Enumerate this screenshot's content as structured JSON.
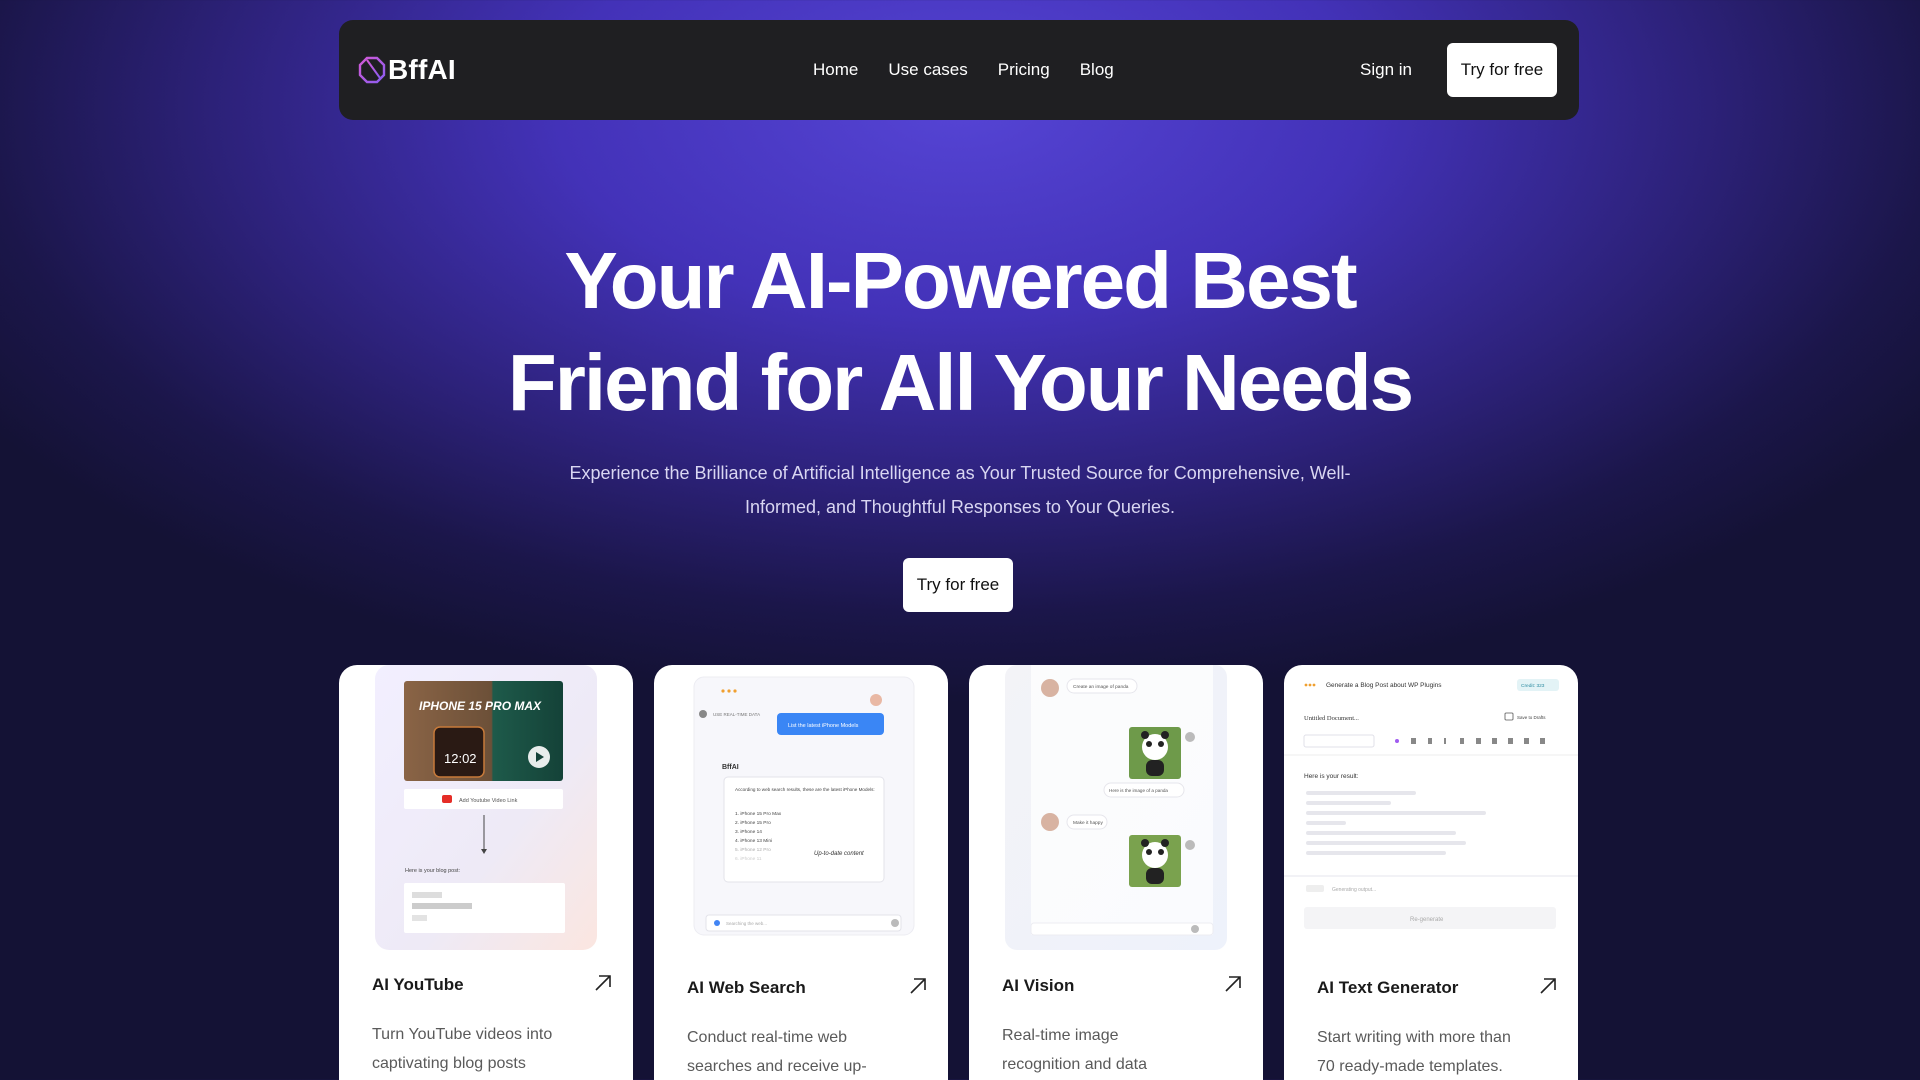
{
  "nav": {
    "logo_text": "BffAI",
    "links": [
      "Home",
      "Use cases",
      "Pricing",
      "Blog"
    ],
    "signin": "Sign in",
    "cta": "Try for free"
  },
  "hero": {
    "title_line1": "Your AI-Powered Best",
    "title_line2": "Friend for All Your Needs",
    "subtitle_line1": "Experience the Brilliance of Artificial Intelligence as Your Trusted Source for Comprehensive, Well-",
    "subtitle_line2": "Informed, and Thoughtful Responses to Your Queries.",
    "cta": "Try for free"
  },
  "cards": [
    {
      "title": "AI YouTube",
      "desc_line1": "Turn YouTube videos into",
      "desc_line2": "captivating blog posts",
      "preview": {
        "video_title": "IPHONE 15 PRO MAX",
        "clock": "12:02",
        "link_label": "Add Youtube Video Link",
        "result_label": "Here is your blog post:"
      }
    },
    {
      "title": "AI Web Search",
      "desc_line1": "Conduct real-time web",
      "desc_line2": "searches and receive up-",
      "preview": {
        "toggle_label": "USE REAL-TIME DATA",
        "query": "List the latest iPhone Models",
        "brand": "BffAI",
        "answer_intro": "According to web search results, these are the latest iPhone Models:",
        "items": [
          "1. iPhone 15 Pro Max",
          "2. iPhone 15 Pro",
          "3. iPhone 14",
          "4. iPhone 13 Mini",
          "5. iPhone 12 Pro",
          "6. iPhone 11"
        ],
        "note": "Up-to-date content",
        "search_status": "Searching the web..."
      }
    },
    {
      "title": "AI Vision",
      "desc_line1": "Real-time image",
      "desc_line2": "recognition and data",
      "preview": {
        "prompt1": "Create an image of panda",
        "caption1": "Here is the image of a panda",
        "prompt2": "Make it happy"
      }
    },
    {
      "title": "AI Text Generator",
      "desc_line1": "Start writing with more than",
      "desc_line2": "70 ready-made templates.",
      "preview": {
        "header": "Generate a Blog Post about WP Plugins",
        "credit": "Credit: 323",
        "doc_title": "Untitled Document...",
        "save_label": "Save to Drafts",
        "result_label": "Here is your result:",
        "status": "Generating output...",
        "regenerate": "Re-generate"
      }
    }
  ],
  "colors": {
    "nav_bg": "#1f1f22",
    "accent_gradient": [
      "#5544d4",
      "#141235"
    ],
    "logo_gradient": [
      "#c84fd8",
      "#7b5cf0"
    ]
  }
}
